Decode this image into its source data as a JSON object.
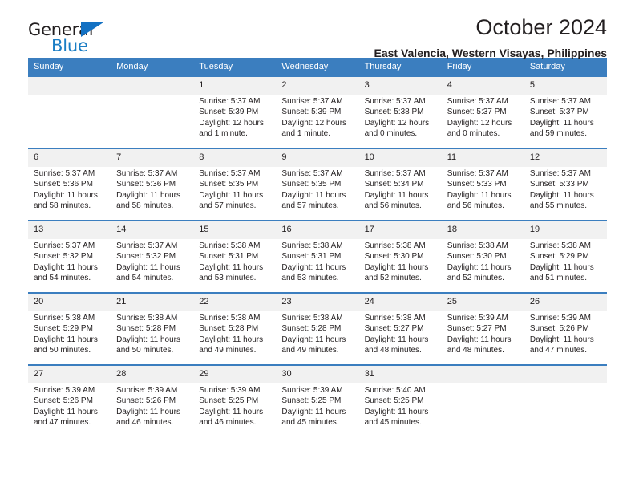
{
  "brand": {
    "name_top": "General",
    "name_bottom": "Blue",
    "triangle_color": "#1371c3",
    "blue_color": "#1a7dc4"
  },
  "header": {
    "month_title": "October 2024",
    "location": "East Valencia, Western Visayas, Philippines",
    "header_bg": "#3b7ebf",
    "header_text_color": "#ffffff"
  },
  "weekday_headers": [
    "Sunday",
    "Monday",
    "Tuesday",
    "Wednesday",
    "Thursday",
    "Friday",
    "Saturday"
  ],
  "weeks": [
    [
      {
        "day": "",
        "sunrise": "",
        "sunset": "",
        "daylight_1": "",
        "daylight_2": ""
      },
      {
        "day": "",
        "sunrise": "",
        "sunset": "",
        "daylight_1": "",
        "daylight_2": ""
      },
      {
        "day": "1",
        "sunrise": "Sunrise: 5:37 AM",
        "sunset": "Sunset: 5:39 PM",
        "daylight_1": "Daylight: 12 hours",
        "daylight_2": "and 1 minute."
      },
      {
        "day": "2",
        "sunrise": "Sunrise: 5:37 AM",
        "sunset": "Sunset: 5:39 PM",
        "daylight_1": "Daylight: 12 hours",
        "daylight_2": "and 1 minute."
      },
      {
        "day": "3",
        "sunrise": "Sunrise: 5:37 AM",
        "sunset": "Sunset: 5:38 PM",
        "daylight_1": "Daylight: 12 hours",
        "daylight_2": "and 0 minutes."
      },
      {
        "day": "4",
        "sunrise": "Sunrise: 5:37 AM",
        "sunset": "Sunset: 5:37 PM",
        "daylight_1": "Daylight: 12 hours",
        "daylight_2": "and 0 minutes."
      },
      {
        "day": "5",
        "sunrise": "Sunrise: 5:37 AM",
        "sunset": "Sunset: 5:37 PM",
        "daylight_1": "Daylight: 11 hours",
        "daylight_2": "and 59 minutes."
      }
    ],
    [
      {
        "day": "6",
        "sunrise": "Sunrise: 5:37 AM",
        "sunset": "Sunset: 5:36 PM",
        "daylight_1": "Daylight: 11 hours",
        "daylight_2": "and 58 minutes."
      },
      {
        "day": "7",
        "sunrise": "Sunrise: 5:37 AM",
        "sunset": "Sunset: 5:36 PM",
        "daylight_1": "Daylight: 11 hours",
        "daylight_2": "and 58 minutes."
      },
      {
        "day": "8",
        "sunrise": "Sunrise: 5:37 AM",
        "sunset": "Sunset: 5:35 PM",
        "daylight_1": "Daylight: 11 hours",
        "daylight_2": "and 57 minutes."
      },
      {
        "day": "9",
        "sunrise": "Sunrise: 5:37 AM",
        "sunset": "Sunset: 5:35 PM",
        "daylight_1": "Daylight: 11 hours",
        "daylight_2": "and 57 minutes."
      },
      {
        "day": "10",
        "sunrise": "Sunrise: 5:37 AM",
        "sunset": "Sunset: 5:34 PM",
        "daylight_1": "Daylight: 11 hours",
        "daylight_2": "and 56 minutes."
      },
      {
        "day": "11",
        "sunrise": "Sunrise: 5:37 AM",
        "sunset": "Sunset: 5:33 PM",
        "daylight_1": "Daylight: 11 hours",
        "daylight_2": "and 56 minutes."
      },
      {
        "day": "12",
        "sunrise": "Sunrise: 5:37 AM",
        "sunset": "Sunset: 5:33 PM",
        "daylight_1": "Daylight: 11 hours",
        "daylight_2": "and 55 minutes."
      }
    ],
    [
      {
        "day": "13",
        "sunrise": "Sunrise: 5:37 AM",
        "sunset": "Sunset: 5:32 PM",
        "daylight_1": "Daylight: 11 hours",
        "daylight_2": "and 54 minutes."
      },
      {
        "day": "14",
        "sunrise": "Sunrise: 5:37 AM",
        "sunset": "Sunset: 5:32 PM",
        "daylight_1": "Daylight: 11 hours",
        "daylight_2": "and 54 minutes."
      },
      {
        "day": "15",
        "sunrise": "Sunrise: 5:38 AM",
        "sunset": "Sunset: 5:31 PM",
        "daylight_1": "Daylight: 11 hours",
        "daylight_2": "and 53 minutes."
      },
      {
        "day": "16",
        "sunrise": "Sunrise: 5:38 AM",
        "sunset": "Sunset: 5:31 PM",
        "daylight_1": "Daylight: 11 hours",
        "daylight_2": "and 53 minutes."
      },
      {
        "day": "17",
        "sunrise": "Sunrise: 5:38 AM",
        "sunset": "Sunset: 5:30 PM",
        "daylight_1": "Daylight: 11 hours",
        "daylight_2": "and 52 minutes."
      },
      {
        "day": "18",
        "sunrise": "Sunrise: 5:38 AM",
        "sunset": "Sunset: 5:30 PM",
        "daylight_1": "Daylight: 11 hours",
        "daylight_2": "and 52 minutes."
      },
      {
        "day": "19",
        "sunrise": "Sunrise: 5:38 AM",
        "sunset": "Sunset: 5:29 PM",
        "daylight_1": "Daylight: 11 hours",
        "daylight_2": "and 51 minutes."
      }
    ],
    [
      {
        "day": "20",
        "sunrise": "Sunrise: 5:38 AM",
        "sunset": "Sunset: 5:29 PM",
        "daylight_1": "Daylight: 11 hours",
        "daylight_2": "and 50 minutes."
      },
      {
        "day": "21",
        "sunrise": "Sunrise: 5:38 AM",
        "sunset": "Sunset: 5:28 PM",
        "daylight_1": "Daylight: 11 hours",
        "daylight_2": "and 50 minutes."
      },
      {
        "day": "22",
        "sunrise": "Sunrise: 5:38 AM",
        "sunset": "Sunset: 5:28 PM",
        "daylight_1": "Daylight: 11 hours",
        "daylight_2": "and 49 minutes."
      },
      {
        "day": "23",
        "sunrise": "Sunrise: 5:38 AM",
        "sunset": "Sunset: 5:28 PM",
        "daylight_1": "Daylight: 11 hours",
        "daylight_2": "and 49 minutes."
      },
      {
        "day": "24",
        "sunrise": "Sunrise: 5:38 AM",
        "sunset": "Sunset: 5:27 PM",
        "daylight_1": "Daylight: 11 hours",
        "daylight_2": "and 48 minutes."
      },
      {
        "day": "25",
        "sunrise": "Sunrise: 5:39 AM",
        "sunset": "Sunset: 5:27 PM",
        "daylight_1": "Daylight: 11 hours",
        "daylight_2": "and 48 minutes."
      },
      {
        "day": "26",
        "sunrise": "Sunrise: 5:39 AM",
        "sunset": "Sunset: 5:26 PM",
        "daylight_1": "Daylight: 11 hours",
        "daylight_2": "and 47 minutes."
      }
    ],
    [
      {
        "day": "27",
        "sunrise": "Sunrise: 5:39 AM",
        "sunset": "Sunset: 5:26 PM",
        "daylight_1": "Daylight: 11 hours",
        "daylight_2": "and 47 minutes."
      },
      {
        "day": "28",
        "sunrise": "Sunrise: 5:39 AM",
        "sunset": "Sunset: 5:26 PM",
        "daylight_1": "Daylight: 11 hours",
        "daylight_2": "and 46 minutes."
      },
      {
        "day": "29",
        "sunrise": "Sunrise: 5:39 AM",
        "sunset": "Sunset: 5:25 PM",
        "daylight_1": "Daylight: 11 hours",
        "daylight_2": "and 46 minutes."
      },
      {
        "day": "30",
        "sunrise": "Sunrise: 5:39 AM",
        "sunset": "Sunset: 5:25 PM",
        "daylight_1": "Daylight: 11 hours",
        "daylight_2": "and 45 minutes."
      },
      {
        "day": "31",
        "sunrise": "Sunrise: 5:40 AM",
        "sunset": "Sunset: 5:25 PM",
        "daylight_1": "Daylight: 11 hours",
        "daylight_2": "and 45 minutes."
      },
      {
        "day": "",
        "sunrise": "",
        "sunset": "",
        "daylight_1": "",
        "daylight_2": ""
      },
      {
        "day": "",
        "sunrise": "",
        "sunset": "",
        "daylight_1": "",
        "daylight_2": ""
      }
    ]
  ]
}
